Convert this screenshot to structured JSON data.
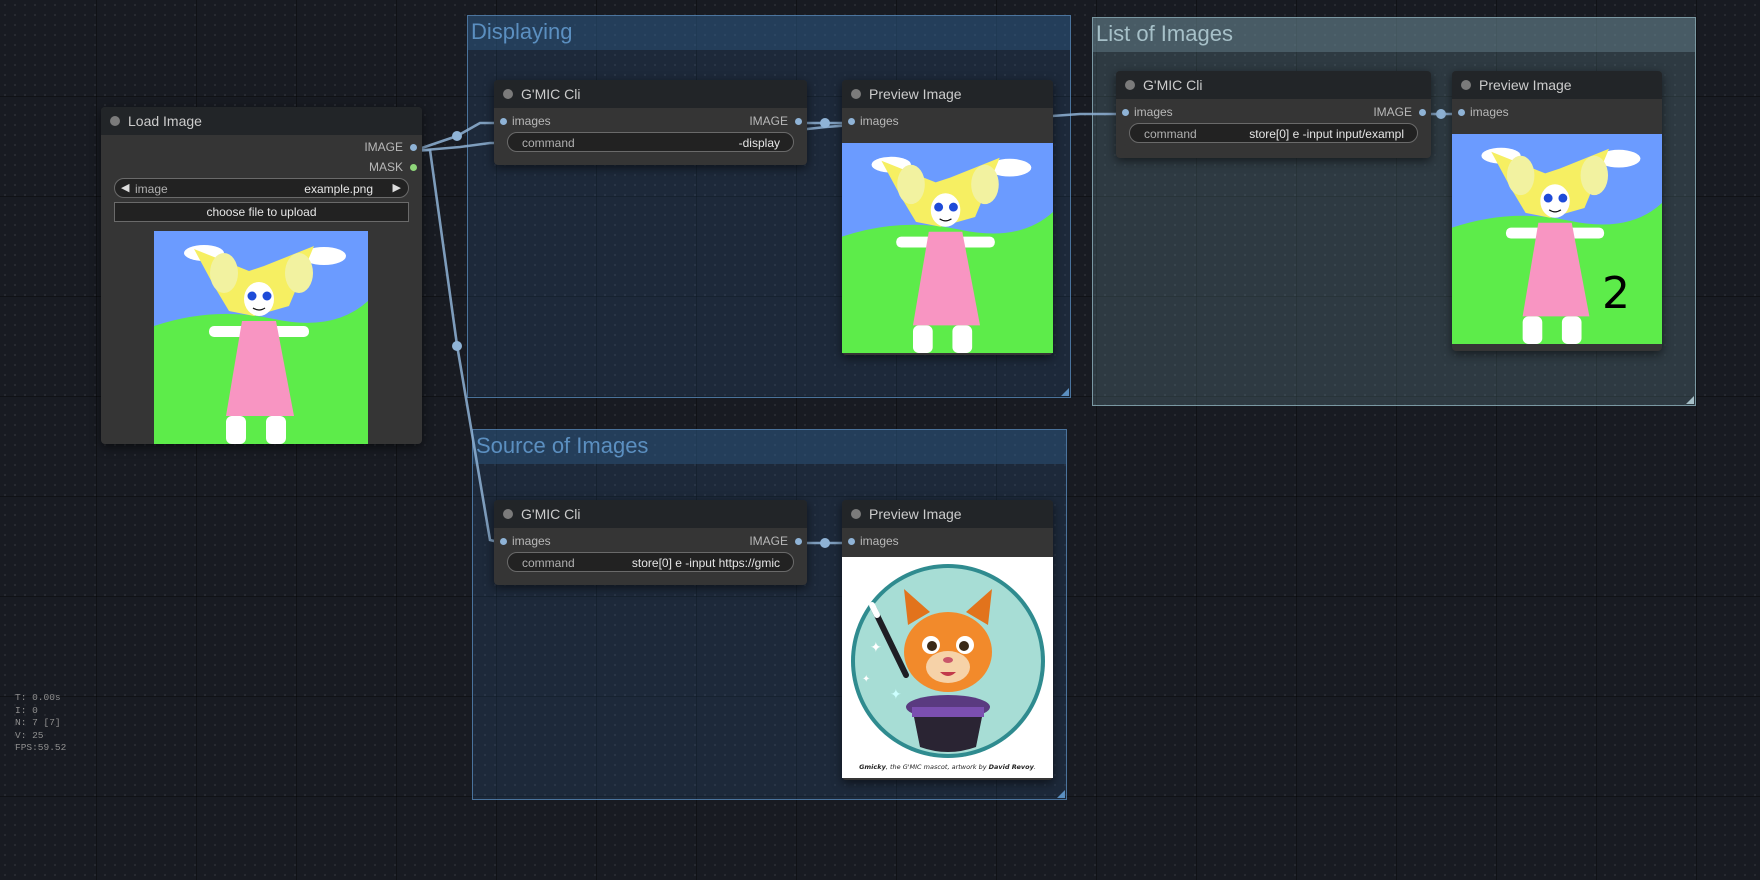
{
  "groups": {
    "displaying": "Displaying",
    "list_of_images": "List of Images",
    "source_of_images": "Source of Images"
  },
  "load_image": {
    "title": "Load Image",
    "out_image": "IMAGE",
    "out_mask": "MASK",
    "widget_label": "image",
    "widget_value": "example.png",
    "upload_button": "choose file to upload"
  },
  "gmic_display": {
    "title": "G'MIC Cli",
    "in_images": "images",
    "out_image": "IMAGE",
    "command_label": "command",
    "command_value": "-display"
  },
  "preview_display": {
    "title": "Preview Image",
    "in_images": "images"
  },
  "gmic_list": {
    "title": "G'MIC Cli",
    "in_images": "images",
    "out_image": "IMAGE",
    "command_label": "command",
    "command_value": "store[0] e -input input/exampl"
  },
  "preview_list": {
    "title": "Preview Image",
    "in_images": "images",
    "batch_count": "2"
  },
  "gmic_source": {
    "title": "G'MIC Cli",
    "in_images": "images",
    "out_image": "IMAGE",
    "command_label": "command",
    "command_value": "store[0] e -input https://gmic"
  },
  "preview_source": {
    "title": "Preview Image",
    "in_images": "images",
    "caption_name": "Gmicky",
    "caption_middle": ", the G'MIC mascot, artwork by ",
    "caption_artist": "David Revoy"
  },
  "stats": {
    "t": "T: 0.00s",
    "i": "I: 0",
    "n": "N: 7 [7]",
    "v": "V: 25",
    "fps": "FPS:59.52"
  },
  "colors": {
    "background": "#181b22",
    "node_body": "#353535",
    "node_header": "#222528",
    "link": "#8fb3d6",
    "group_blue": "#5b8fc0",
    "group_teal": "#a6c0c8"
  }
}
